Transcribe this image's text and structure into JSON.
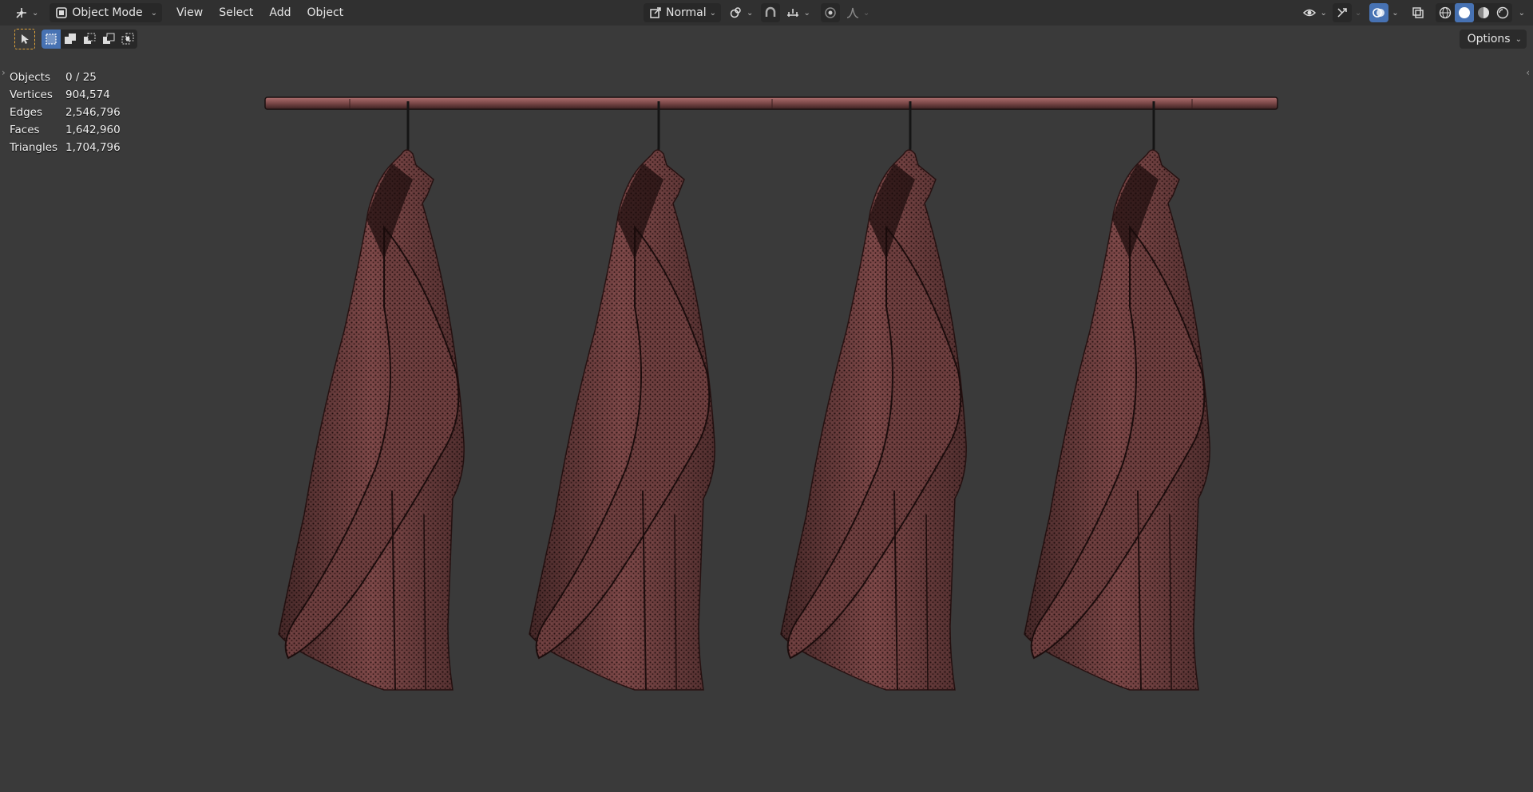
{
  "header": {
    "mode_label": "Object Mode",
    "menus": [
      "View",
      "Select",
      "Add",
      "Object"
    ],
    "orientation_label": "Normal"
  },
  "toolbar": {
    "options_label": "Options"
  },
  "stats": {
    "objects": {
      "label": "Objects",
      "value": "0 / 25"
    },
    "vertices": {
      "label": "Vertices",
      "value": "904,574"
    },
    "edges": {
      "label": "Edges",
      "value": "2,546,796"
    },
    "faces": {
      "label": "Faces",
      "value": "1,642,960"
    },
    "triangles": {
      "label": "Triangles",
      "value": "1,704,796"
    }
  },
  "icons": {
    "editor_type": "editor-type-icon",
    "mode": "object-mode-icon",
    "transform_orientation": "transform-orientation-icon",
    "pivot": "pivot-point-icon",
    "snap": "snap-icon",
    "snap_target": "snap-target-icon",
    "proportional": "proportional-editing-icon",
    "falloff": "falloff-curve-icon",
    "visibility": "visibility-eye-icon",
    "gizmo": "gizmo-icon",
    "overlays": "overlays-icon",
    "xray": "xray-icon",
    "shading": [
      "wireframe-shading-icon",
      "solid-shading-icon",
      "material-shading-icon",
      "rendered-shading-icon"
    ]
  },
  "colors": {
    "accent": "#4772b3",
    "mesh": "#8a5050",
    "background": "#3a3a3a",
    "header": "#303030"
  }
}
